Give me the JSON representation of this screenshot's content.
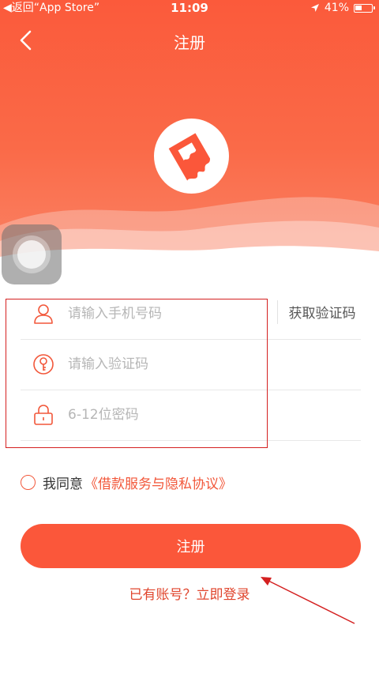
{
  "status_bar": {
    "back_app": "◀返回“App Store”",
    "time": "11:09",
    "battery_percent": "41%",
    "battery_level": 0.41
  },
  "nav": {
    "title": "注册"
  },
  "form": {
    "phone": {
      "placeholder": "请输入手机号码",
      "value": "",
      "icon": "user-icon"
    },
    "code": {
      "placeholder": "请输入验证码",
      "value": "",
      "icon": "key-icon",
      "get_code_label": "获取验证码"
    },
    "password": {
      "placeholder": "6-12位密码",
      "value": "",
      "icon": "lock-icon"
    }
  },
  "agreement": {
    "text": "我同意",
    "link": "《借款服务与隐私协议》",
    "checked": false
  },
  "register_button": "注册",
  "login_link": "已有账号？立即登录",
  "colors": {
    "brand": "#fb573a",
    "annotation": "#d42020"
  }
}
